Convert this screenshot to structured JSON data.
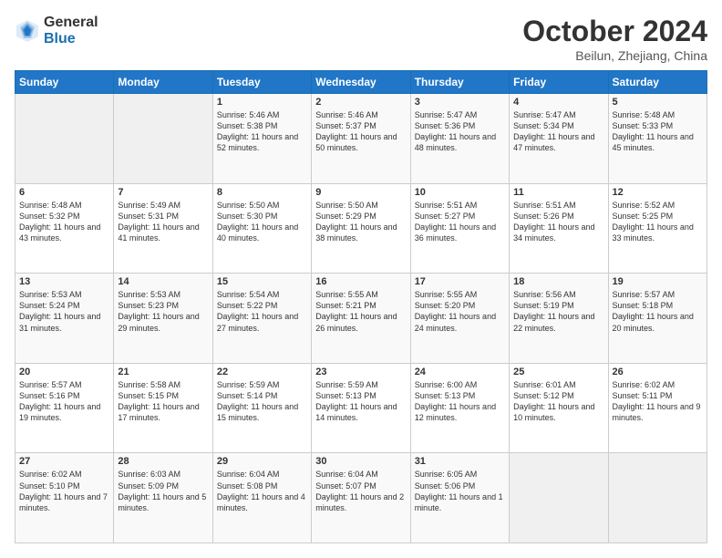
{
  "logo": {
    "general": "General",
    "blue": "Blue"
  },
  "title": "October 2024",
  "location": "Beilun, Zhejiang, China",
  "days_header": [
    "Sunday",
    "Monday",
    "Tuesday",
    "Wednesday",
    "Thursday",
    "Friday",
    "Saturday"
  ],
  "weeks": [
    [
      {
        "day": "",
        "empty": true
      },
      {
        "day": "",
        "empty": true
      },
      {
        "day": "1",
        "sunrise": "Sunrise: 5:46 AM",
        "sunset": "Sunset: 5:38 PM",
        "daylight": "Daylight: 11 hours and 52 minutes."
      },
      {
        "day": "2",
        "sunrise": "Sunrise: 5:46 AM",
        "sunset": "Sunset: 5:37 PM",
        "daylight": "Daylight: 11 hours and 50 minutes."
      },
      {
        "day": "3",
        "sunrise": "Sunrise: 5:47 AM",
        "sunset": "Sunset: 5:36 PM",
        "daylight": "Daylight: 11 hours and 48 minutes."
      },
      {
        "day": "4",
        "sunrise": "Sunrise: 5:47 AM",
        "sunset": "Sunset: 5:34 PM",
        "daylight": "Daylight: 11 hours and 47 minutes."
      },
      {
        "day": "5",
        "sunrise": "Sunrise: 5:48 AM",
        "sunset": "Sunset: 5:33 PM",
        "daylight": "Daylight: 11 hours and 45 minutes."
      }
    ],
    [
      {
        "day": "6",
        "sunrise": "Sunrise: 5:48 AM",
        "sunset": "Sunset: 5:32 PM",
        "daylight": "Daylight: 11 hours and 43 minutes."
      },
      {
        "day": "7",
        "sunrise": "Sunrise: 5:49 AM",
        "sunset": "Sunset: 5:31 PM",
        "daylight": "Daylight: 11 hours and 41 minutes."
      },
      {
        "day": "8",
        "sunrise": "Sunrise: 5:50 AM",
        "sunset": "Sunset: 5:30 PM",
        "daylight": "Daylight: 11 hours and 40 minutes."
      },
      {
        "day": "9",
        "sunrise": "Sunrise: 5:50 AM",
        "sunset": "Sunset: 5:29 PM",
        "daylight": "Daylight: 11 hours and 38 minutes."
      },
      {
        "day": "10",
        "sunrise": "Sunrise: 5:51 AM",
        "sunset": "Sunset: 5:27 PM",
        "daylight": "Daylight: 11 hours and 36 minutes."
      },
      {
        "day": "11",
        "sunrise": "Sunrise: 5:51 AM",
        "sunset": "Sunset: 5:26 PM",
        "daylight": "Daylight: 11 hours and 34 minutes."
      },
      {
        "day": "12",
        "sunrise": "Sunrise: 5:52 AM",
        "sunset": "Sunset: 5:25 PM",
        "daylight": "Daylight: 11 hours and 33 minutes."
      }
    ],
    [
      {
        "day": "13",
        "sunrise": "Sunrise: 5:53 AM",
        "sunset": "Sunset: 5:24 PM",
        "daylight": "Daylight: 11 hours and 31 minutes."
      },
      {
        "day": "14",
        "sunrise": "Sunrise: 5:53 AM",
        "sunset": "Sunset: 5:23 PM",
        "daylight": "Daylight: 11 hours and 29 minutes."
      },
      {
        "day": "15",
        "sunrise": "Sunrise: 5:54 AM",
        "sunset": "Sunset: 5:22 PM",
        "daylight": "Daylight: 11 hours and 27 minutes."
      },
      {
        "day": "16",
        "sunrise": "Sunrise: 5:55 AM",
        "sunset": "Sunset: 5:21 PM",
        "daylight": "Daylight: 11 hours and 26 minutes."
      },
      {
        "day": "17",
        "sunrise": "Sunrise: 5:55 AM",
        "sunset": "Sunset: 5:20 PM",
        "daylight": "Daylight: 11 hours and 24 minutes."
      },
      {
        "day": "18",
        "sunrise": "Sunrise: 5:56 AM",
        "sunset": "Sunset: 5:19 PM",
        "daylight": "Daylight: 11 hours and 22 minutes."
      },
      {
        "day": "19",
        "sunrise": "Sunrise: 5:57 AM",
        "sunset": "Sunset: 5:18 PM",
        "daylight": "Daylight: 11 hours and 20 minutes."
      }
    ],
    [
      {
        "day": "20",
        "sunrise": "Sunrise: 5:57 AM",
        "sunset": "Sunset: 5:16 PM",
        "daylight": "Daylight: 11 hours and 19 minutes."
      },
      {
        "day": "21",
        "sunrise": "Sunrise: 5:58 AM",
        "sunset": "Sunset: 5:15 PM",
        "daylight": "Daylight: 11 hours and 17 minutes."
      },
      {
        "day": "22",
        "sunrise": "Sunrise: 5:59 AM",
        "sunset": "Sunset: 5:14 PM",
        "daylight": "Daylight: 11 hours and 15 minutes."
      },
      {
        "day": "23",
        "sunrise": "Sunrise: 5:59 AM",
        "sunset": "Sunset: 5:13 PM",
        "daylight": "Daylight: 11 hours and 14 minutes."
      },
      {
        "day": "24",
        "sunrise": "Sunrise: 6:00 AM",
        "sunset": "Sunset: 5:13 PM",
        "daylight": "Daylight: 11 hours and 12 minutes."
      },
      {
        "day": "25",
        "sunrise": "Sunrise: 6:01 AM",
        "sunset": "Sunset: 5:12 PM",
        "daylight": "Daylight: 11 hours and 10 minutes."
      },
      {
        "day": "26",
        "sunrise": "Sunrise: 6:02 AM",
        "sunset": "Sunset: 5:11 PM",
        "daylight": "Daylight: 11 hours and 9 minutes."
      }
    ],
    [
      {
        "day": "27",
        "sunrise": "Sunrise: 6:02 AM",
        "sunset": "Sunset: 5:10 PM",
        "daylight": "Daylight: 11 hours and 7 minutes."
      },
      {
        "day": "28",
        "sunrise": "Sunrise: 6:03 AM",
        "sunset": "Sunset: 5:09 PM",
        "daylight": "Daylight: 11 hours and 5 minutes."
      },
      {
        "day": "29",
        "sunrise": "Sunrise: 6:04 AM",
        "sunset": "Sunset: 5:08 PM",
        "daylight": "Daylight: 11 hours and 4 minutes."
      },
      {
        "day": "30",
        "sunrise": "Sunrise: 6:04 AM",
        "sunset": "Sunset: 5:07 PM",
        "daylight": "Daylight: 11 hours and 2 minutes."
      },
      {
        "day": "31",
        "sunrise": "Sunrise: 6:05 AM",
        "sunset": "Sunset: 5:06 PM",
        "daylight": "Daylight: 11 hours and 1 minute."
      },
      {
        "day": "",
        "empty": true
      },
      {
        "day": "",
        "empty": true
      }
    ]
  ]
}
